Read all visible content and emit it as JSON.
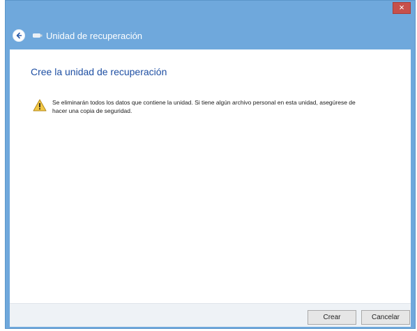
{
  "window": {
    "close_glyph": "×"
  },
  "nav": {
    "title": "Unidad de recuperación"
  },
  "main": {
    "heading": "Cree la unidad de recuperación",
    "warning_text": "Se eliminarán todos los datos que contiene la unidad. Si tiene algún archivo personal en esta unidad, asegúrese de hacer una copia de seguridad."
  },
  "footer": {
    "create_label": "Crear",
    "cancel_label": "Cancelar"
  },
  "colors": {
    "window_frame": "#6fa8dc",
    "heading": "#1e4fa3",
    "close_button": "#c7504b",
    "warning_yellow": "#f2c744"
  },
  "icons": {
    "back": "back-arrow-icon",
    "drive": "usb-drive-icon",
    "warning": "warning-icon",
    "close": "close-icon"
  }
}
